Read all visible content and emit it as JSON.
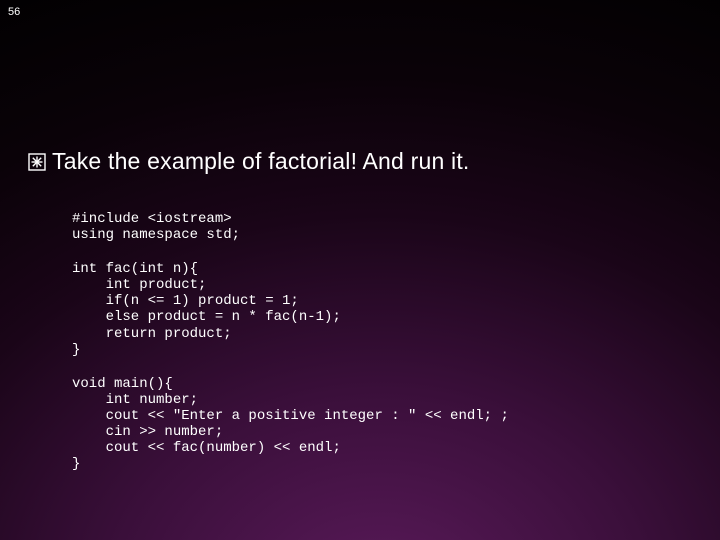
{
  "slide": {
    "number": "56",
    "heading": "Take the example of factorial! And run it.",
    "code_block_1": "#include <iostream>\nusing namespace std;",
    "code_block_2": "int fac(int n){\n    int product;\n    if(n <= 1) product = 1;\n    else product = n * fac(n-1);\n    return product;\n}",
    "code_block_3": "void main(){\n    int number;\n    cout << \"Enter a positive integer : \" << endl; ;\n    cin >> number;\n    cout << fac(number) << endl;\n}"
  }
}
